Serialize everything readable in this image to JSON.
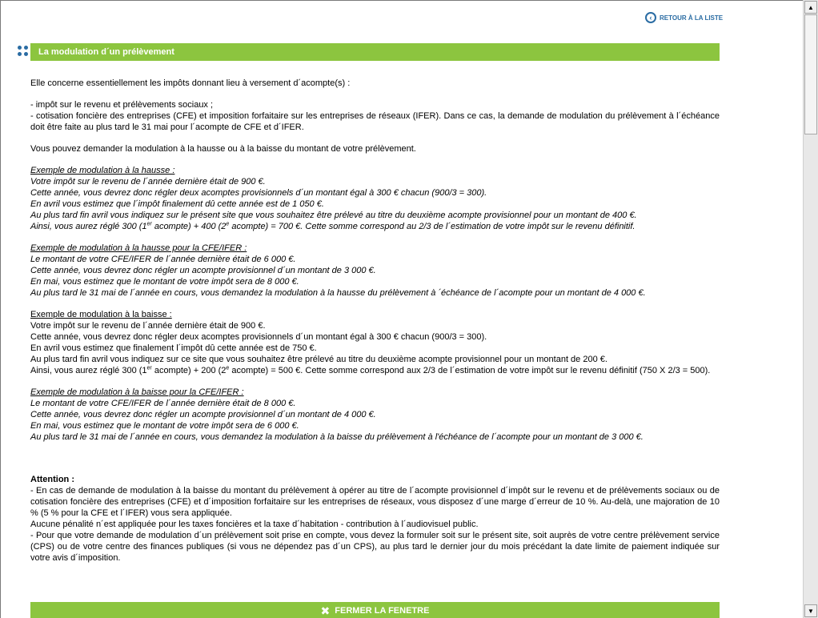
{
  "header": {
    "back_label": "RETOUR À LA LISTE",
    "title": "La modulation d´un prélèvement"
  },
  "intro": {
    "l1": "Elle concerne essentiellement les impôts donnant lieu à versement d´acompte(s) :",
    "l2": "- impôt sur le revenu et prélèvements sociaux ;",
    "l3": "- cotisation foncière des entreprises (CFE) et imposition forfaitaire sur les entreprises de réseaux (IFER). Dans ce cas, la demande de modulation du prélèvement à l´échéance doit être faite au plus tard le 31 mai pour l´acompte de CFE et d´IFER.",
    "l4": "Vous pouvez demander la modulation à la hausse ou à la baisse du montant de votre prélèvement."
  },
  "ex1": {
    "title": "Exemple de modulation à la hausse :",
    "l1": "Votre impôt sur le revenu de l´année dernière était de 900 €.",
    "l2": "Cette année, vous devrez donc régler deux acomptes provisionnels d´un montant égal à 300 € chacun (900/3 = 300).",
    "l3": "En avril vous estimez que l´impôt finalement dû cette année est de 1 050 €.",
    "l4": "Au plus tard fin avril vous indiquez sur le présent site que vous souhaitez être prélevé au titre du deuxième acompte provisionnel pour un montant de 400 €.",
    "l5a": "Ainsi, vous aurez réglé 300 (1",
    "l5b": "er",
    "l5c": " acompte) + 400 (2",
    "l5d": "e",
    "l5e": " acompte) = 700 €. Cette somme correspond au 2/3 de l´estimation de votre impôt sur le revenu définitif."
  },
  "ex2": {
    "title": "Exemple de modulation à la hausse pour la CFE/IFER :",
    "l1": "Le montant de votre CFE/IFER de l´année dernière était de 6 000 €.",
    "l2": "Cette année, vous devrez donc régler un acompte provisionnel d´un montant de 3 000 €.",
    "l3": "En mai, vous estimez que le montant de votre impôt sera de 8 000 €.",
    "l4": "Au plus tard le 31 mai de l´année en cours, vous demandez la modulation à la hausse du prélèvement à ´échéance de l´acompte pour un montant de 4 000 €."
  },
  "ex3": {
    "title": "Exemple de modulation à la baisse  :",
    "l1": "Votre impôt sur le revenu de l´année dernière était de 900 €.",
    "l2": "Cette année, vous devrez donc régler deux acomptes provisionnels d´un montant égal à 300 € chacun (900/3 = 300).",
    "l3": "En avril vous estimez que finalement l´impôt dû cette année est de 750 €.",
    "l4": "Au plus tard fin avril vous indiquez sur ce site que vous souhaitez être prélevé au titre du deuxième acompte provisionnel pour un montant de 200 €.",
    "l5a": "Ainsi, vous aurez réglé 300 (1",
    "l5b": "er",
    "l5c": " acompte) + 200 (2",
    "l5d": "e",
    "l5e": " acompte) = 500 €. Cette somme correspond aux 2/3 de l´estimation de votre impôt sur le revenu définitif (750 X 2/3 = 500)."
  },
  "ex4": {
    "title": "Exemple de modulation à la baisse pour la CFE/IFER :",
    "l1": "Le montant de votre CFE/IFER de l´année dernière était de 8 000 €.",
    "l2": "Cette année, vous devrez donc régler un acompte provisionnel d´un montant de 4 000 €.",
    "l3": "En mai, vous estimez que le montant de votre impôt sera de 6 000 €.",
    "l4": "Au plus tard le 31 mai de l´année en cours, vous demandez la modulation à la baisse du prélèvement à l'échéance de l´acompte pour un montant de 3 000 €."
  },
  "attention": {
    "title": "Attention :",
    "l1": "- En cas de demande de modulation à la baisse du montant du prélèvement à opérer au titre de l´acompte provisionnel d´impôt sur le revenu et de prélèvements sociaux ou de cotisation foncière des entreprises (CFE) et d´imposition forfaitaire sur les entreprises de réseaux, vous disposez d´une marge d´erreur de 10 %. Au-delà, une majoration de 10 % (5 % pour la CFE et l´IFER) vous sera appliquée.",
    "l2": "Aucune pénalité n´est appliquée pour les taxes foncières et la taxe d´habitation - contribution à l´audiovisuel public.",
    "l3": "- Pour que votre demande de modulation d´un prélèvement soit prise en compte, vous devez la formuler soit sur le présent site, soit auprès de votre centre prélèvement service (CPS) ou de votre centre des finances publiques (si vous ne dépendez pas d´un CPS), au plus tard le dernier jour du mois précédant la date limite de paiement indiquée sur votre avis d´imposition."
  },
  "footer": {
    "close_label": "FERMER LA FENETRE"
  },
  "icons": {
    "back": "arrow-left-circle-icon",
    "section": "dots-grid-icon",
    "close": "close-x-icon"
  },
  "colors": {
    "accent_green": "#8cc53f",
    "link_blue": "#2a6ca3"
  }
}
